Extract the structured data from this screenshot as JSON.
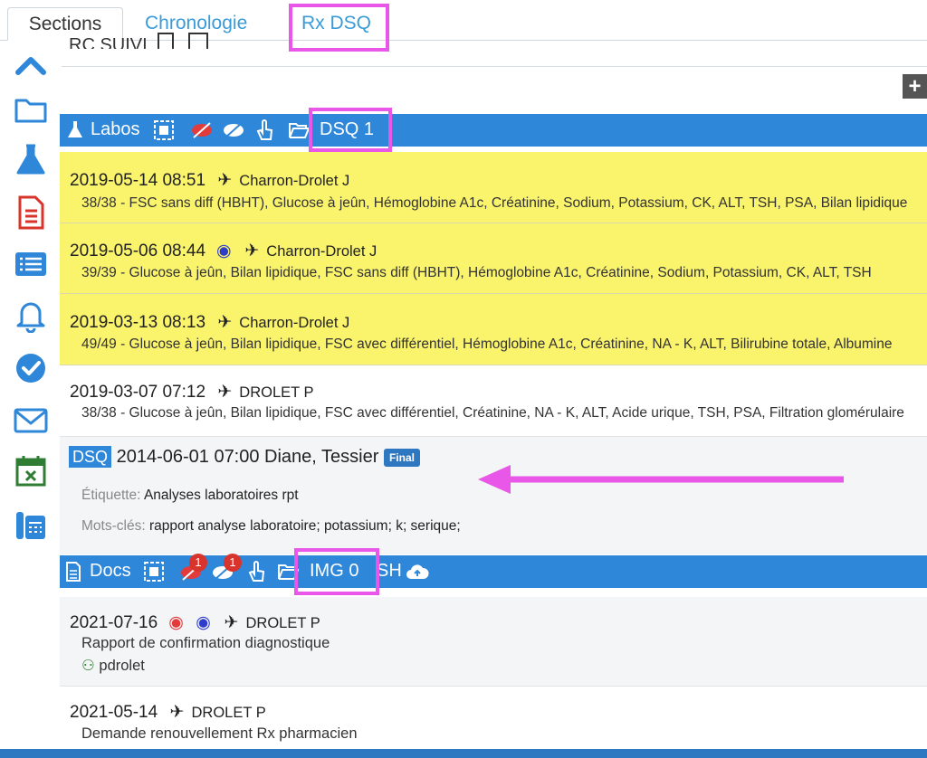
{
  "tabs": [
    {
      "label": "Sections"
    },
    {
      "label": "Chronologie"
    },
    {
      "label": "Rx DSQ"
    }
  ],
  "header": {
    "rc_text": "RC SUIVI"
  },
  "labos": {
    "title": "Labos",
    "dsq_label": "DSQ 1",
    "entries": [
      {
        "date": "2019-05-14 08:51",
        "author": "Charron-Drolet J",
        "detail": "38/38 - FSC sans diff (HBHT), Glucose à jeûn, Hémoglobine A1c, Créatinine, Sodium, Potassium, CK, ALT, TSH, PSA, Bilan lipidique"
      },
      {
        "date": "2019-05-06 08:44",
        "author": "Charron-Drolet J",
        "detail": "39/39 - Glucose à jeûn, Bilan lipidique, FSC sans diff (HBHT), Hémoglobine A1c, Créatinine, Sodium, Potassium, CK, ALT, TSH"
      },
      {
        "date": "2019-03-13 08:13",
        "author": "Charron-Drolet J",
        "detail": "49/49 - Glucose à jeûn, Bilan lipidique, FSC avec différentiel, Hémoglobine A1c, Créatinine, NA - K, ALT, Bilirubine totale, Albumine"
      },
      {
        "date": "2019-03-07 07:12",
        "author": "DROLET P",
        "detail": "38/38 - Glucose à jeûn, Bilan lipidique, FSC avec différentiel, Créatinine, NA - K, ALT, Acide urique, TSH, PSA, Filtration glomérulaire"
      }
    ],
    "dsq_entry": {
      "tag": "DSQ",
      "date": "2014-06-01 07:00 Diane, Tessier",
      "badge": "Final",
      "etiquette_label": "Étiquette:",
      "etiquette_value": "Analyses laboratoires rpt",
      "mots_label": "Mots-clés:",
      "mots_value": "rapport analyse laboratoire; potassium; k; serique;"
    }
  },
  "docs": {
    "title": "Docs",
    "badge_count_1": "1",
    "badge_count_2": "1",
    "img_label": "IMG 0",
    "sh_label": "SH",
    "entries": [
      {
        "date": "2021-07-16",
        "author": "DROLET P",
        "title": "Rapport de confirmation diagnostique",
        "user": "pdrolet"
      },
      {
        "date": "2021-05-14",
        "author": "DROLET P",
        "title": "Demande renouvellement Rx pharmacien"
      }
    ]
  },
  "colors": {
    "accent": "#2e87d9",
    "highlight": "#e857e8",
    "yellow": "#faf36c"
  }
}
